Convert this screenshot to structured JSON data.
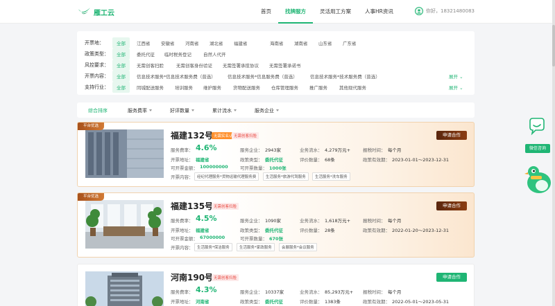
{
  "brand": {
    "name": "雁工云"
  },
  "nav": {
    "items": [
      "首页",
      "找牌服方",
      "灵活用工方案",
      "人事HR资讯"
    ],
    "active": 1
  },
  "user": {
    "greeting": "你好，18321480083"
  },
  "filters": {
    "area": {
      "label": "开票地：",
      "options": [
        "全部",
        "江西省",
        "安徽省",
        "河南省",
        "湖北省",
        "福建省",
        "海南省",
        "湖南省",
        "山东省",
        "广东省"
      ]
    },
    "policy": {
      "label": "政策类型：",
      "options": [
        "全部",
        "委托代征",
        "临时税务登记",
        "自然人代开"
      ]
    },
    "risk": {
      "label": "风控要求：",
      "options": [
        "全部",
        "无需创客扫脸",
        "无需创客身份验证",
        "无需签署承揽协议",
        "无需签署承诺书"
      ]
    },
    "content": {
      "label": "开票内容：",
      "options": [
        "全部",
        "信息技术服务*信息技术服务费（普选）",
        "信息技术服务*信息服务费（普选）",
        "信息技术服务*技术服务费（普选）"
      ],
      "expand": "展开"
    },
    "industry": {
      "label": "支持行业：",
      "options": [
        "全部",
        "同城配送服务",
        "培训服务",
        "维护服务",
        "货物配送服务",
        "仓库管理服务",
        "推广服务",
        "其他现代服务"
      ],
      "expand": "展开"
    }
  },
  "sort": {
    "items": [
      "综合排序",
      "服务费率",
      "好评数量",
      "累计流水",
      "服务企业"
    ]
  },
  "labels": {
    "rate": "服务费率：",
    "address": "开票地址：",
    "amount": "可开票金额：",
    "enterprises": "服务企业：",
    "policy_type": "政策类型：",
    "count": "可开票数量：",
    "flow": "业务流水：",
    "reviews": "评价数量：",
    "tax_time": "报税时间：",
    "valid": "政策有效期：",
    "content": "开票内容："
  },
  "cards": [
    {
      "ribbon": "平台优选",
      "title": "福建132号",
      "tags": [
        "无需实名认证",
        "无需创客扫脸"
      ],
      "apply": "申请合作",
      "rate": "4.6%",
      "address": "福建省",
      "amount": "100000000",
      "enterprises": "2943家",
      "policy_type": "委托代征",
      "count": "1000张",
      "flow": "4,279万元+",
      "reviews": "68条",
      "tax_time": "每个月",
      "valid": "2023-01-01～2023-12-31",
      "contents": [
        "经纪代理服务*货物运输代理服务费",
        "生活服务*旅游代驾服务",
        "生活服务*洗车服务"
      ]
    },
    {
      "ribbon": "平台优选",
      "title": "福建135号",
      "tags": [
        "无需创客扫脸"
      ],
      "apply": "申请合作",
      "rate": "4.5%",
      "address": "福建省",
      "amount": "67000000",
      "enterprises": "1090家",
      "policy_type": "委托代征",
      "count": "670张",
      "flow": "1,618万元+",
      "reviews": "28条",
      "tax_time": "每个月",
      "valid": "2022-01-20～2023-12-31",
      "contents": [
        "生活服务*保洁服务",
        "生活服务*家政服务",
        "会展服务*会议服务"
      ]
    },
    {
      "title": "河南190号",
      "tags": [
        "无需创客扫脸"
      ],
      "apply": "申请合作",
      "rate": "4.3%",
      "address": "河南省",
      "enterprises": "10337家",
      "policy_type": "委托代征",
      "flow": "85,293万元+",
      "reviews": "1383条",
      "tax_time": "每个月",
      "valid": "2022-05-01～2023-05-31"
    }
  ],
  "float": {
    "button": "微信咨询"
  }
}
